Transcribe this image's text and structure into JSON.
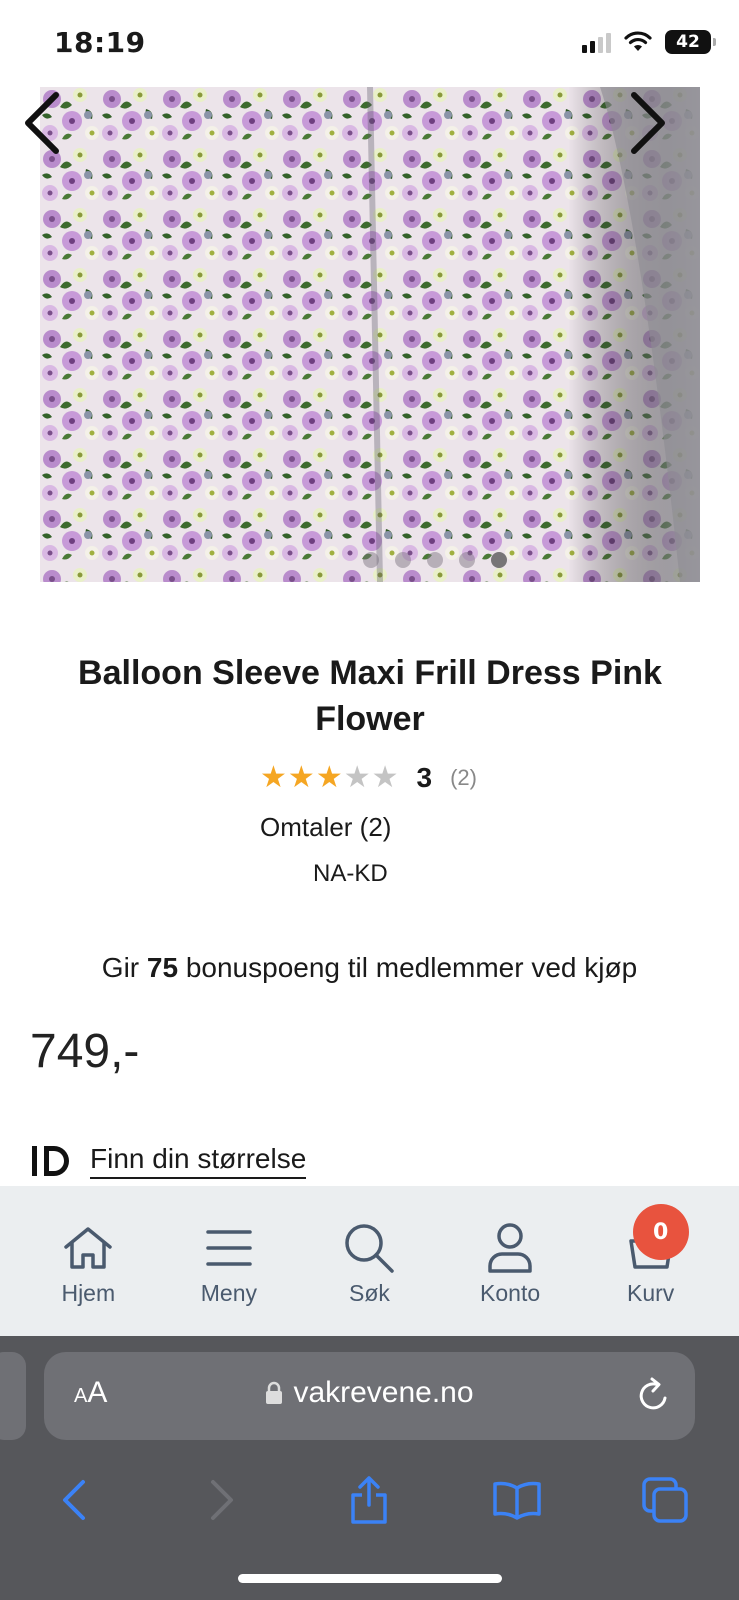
{
  "status_bar": {
    "time": "18:19",
    "battery": "42"
  },
  "product": {
    "title": "Balloon Sleeve Maxi Frill Dress Pink Flower",
    "rating_value": "3",
    "rating_count": "(2)",
    "rating_stars": 3,
    "rating_max": 5,
    "reviews_link": "Omtaler (2)",
    "brand": "NA-KD",
    "bonus_prefix": "Gir",
    "bonus_points": "75",
    "bonus_suffix": "bonuspoeng til medlemmer ved kjøp",
    "price": "749,-",
    "size_finder_label": "Finn din størrelse",
    "gallery_dots": 5,
    "gallery_active_index": 4
  },
  "bottom_nav": {
    "home": "Hjem",
    "menu": "Meny",
    "search": "Søk",
    "account": "Konto",
    "cart": "Kurv",
    "cart_count": "0"
  },
  "browser": {
    "aa_small": "A",
    "aa_big": "A",
    "url": "vakrevene.no"
  },
  "colors": {
    "accent_badge": "#e8533e",
    "star_filled": "#f5a623",
    "star_empty": "#c4c4c4",
    "nav_text": "#4a5a6e",
    "safari_blue": "#3b82f6"
  }
}
